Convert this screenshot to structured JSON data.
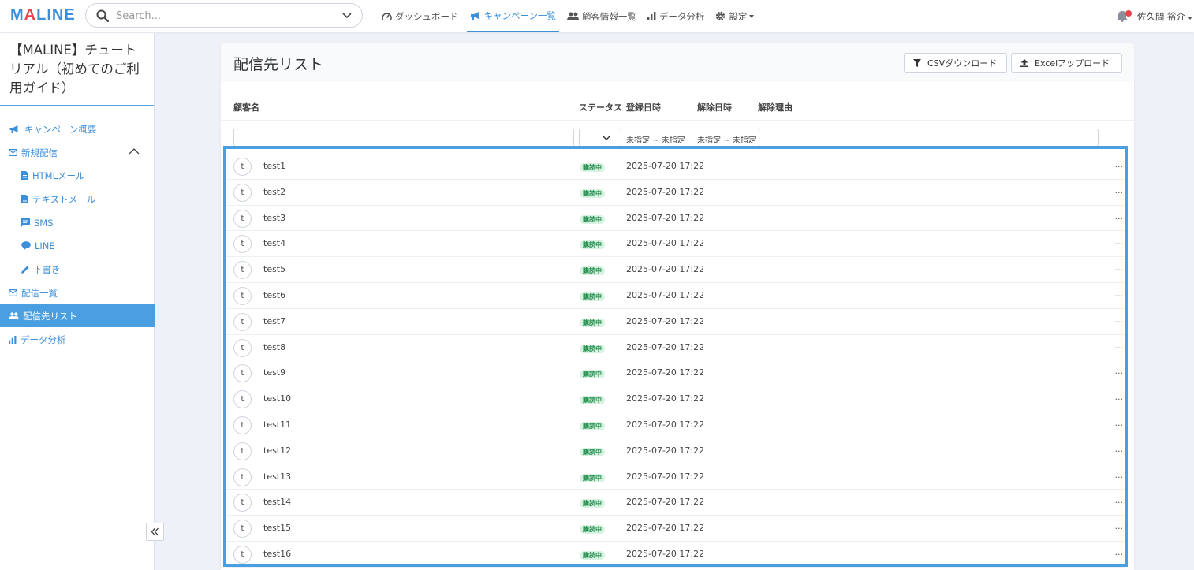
{
  "header": {
    "logo": {
      "pre": "M",
      "accent": "A",
      "post": "LINE"
    },
    "search_placeholder": "Search...",
    "nav": [
      {
        "label": "ダッシュボード",
        "icon": "speedometer-icon"
      },
      {
        "label": "キャンペーン一覧",
        "icon": "megaphone-icon",
        "active": true
      },
      {
        "label": "顧客情報一覧",
        "icon": "users-icon"
      },
      {
        "label": "データ分析",
        "icon": "bar-chart-icon"
      },
      {
        "label": "設定",
        "icon": "gear-icon"
      }
    ],
    "user_name": "佐久間 裕介"
  },
  "sidebar": {
    "title": "【MALINE】チュートリアル（初めてのご利用ガイド）",
    "items": [
      {
        "label": "キャンペーン概要"
      },
      {
        "label": "新規配信"
      },
      {
        "label": "HTMLメール"
      },
      {
        "label": "テキストメール"
      },
      {
        "label": "SMS"
      },
      {
        "label": "LINE"
      },
      {
        "label": "下書き"
      },
      {
        "label": "配信一覧"
      },
      {
        "label": "配信先リスト"
      },
      {
        "label": "データ分析"
      }
    ]
  },
  "panel": {
    "title": "配信先リスト",
    "csv_button": "CSVダウンロード",
    "excel_button": "Excelアップロード",
    "columns": {
      "name": "顧客名",
      "status": "ステータス",
      "registered": "登録日時",
      "cancelled": "解除日時",
      "reason": "解除理由"
    },
    "filters": {
      "registered_range": "未指定 ~ 未指定",
      "cancelled_range": "未指定 ~ 未指定"
    },
    "more_label": "..."
  },
  "rows": [
    {
      "initial": "t",
      "name": "test1",
      "status": "購読中",
      "date": "2025-07-20 17:22"
    },
    {
      "initial": "t",
      "name": "test2",
      "status": "購読中",
      "date": "2025-07-20 17:22"
    },
    {
      "initial": "t",
      "name": "test3",
      "status": "購読中",
      "date": "2025-07-20 17:22"
    },
    {
      "initial": "t",
      "name": "test4",
      "status": "購読中",
      "date": "2025-07-20 17:22"
    },
    {
      "initial": "t",
      "name": "test5",
      "status": "購読中",
      "date": "2025-07-20 17:22"
    },
    {
      "initial": "t",
      "name": "test6",
      "status": "購読中",
      "date": "2025-07-20 17:22"
    },
    {
      "initial": "t",
      "name": "test7",
      "status": "購読中",
      "date": "2025-07-20 17:22"
    },
    {
      "initial": "t",
      "name": "test8",
      "status": "購読中",
      "date": "2025-07-20 17:22"
    },
    {
      "initial": "t",
      "name": "test9",
      "status": "購読中",
      "date": "2025-07-20 17:22"
    },
    {
      "initial": "t",
      "name": "test10",
      "status": "購読中",
      "date": "2025-07-20 17:22"
    },
    {
      "initial": "t",
      "name": "test11",
      "status": "購読中",
      "date": "2025-07-20 17:22"
    },
    {
      "initial": "t",
      "name": "test12",
      "status": "購読中",
      "date": "2025-07-20 17:22"
    },
    {
      "initial": "t",
      "name": "test13",
      "status": "購読中",
      "date": "2025-07-20 17:22"
    },
    {
      "initial": "t",
      "name": "test14",
      "status": "購読中",
      "date": "2025-07-20 17:22"
    },
    {
      "initial": "t",
      "name": "test15",
      "status": "購読中",
      "date": "2025-07-20 17:22"
    },
    {
      "initial": "t",
      "name": "test16",
      "status": "購読中",
      "date": "2025-07-20 17:22"
    }
  ],
  "colors": {
    "accent": "#3d8fd9",
    "logo_accent": "#e8434b",
    "badge_bg": "#d7f2e1",
    "badge_text": "#1b8a47",
    "highlight": "#4a9fe0"
  }
}
